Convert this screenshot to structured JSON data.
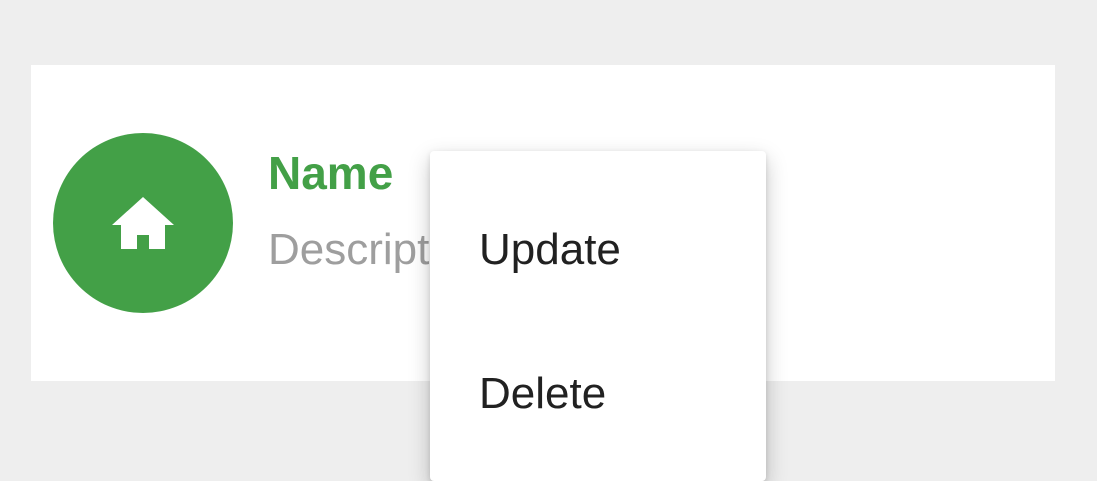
{
  "card": {
    "name": "Name",
    "description": "Description",
    "avatar_icon": "home-icon",
    "accent_color": "#43a047"
  },
  "menu": {
    "items": [
      {
        "label": "Update"
      },
      {
        "label": "Delete"
      }
    ]
  }
}
